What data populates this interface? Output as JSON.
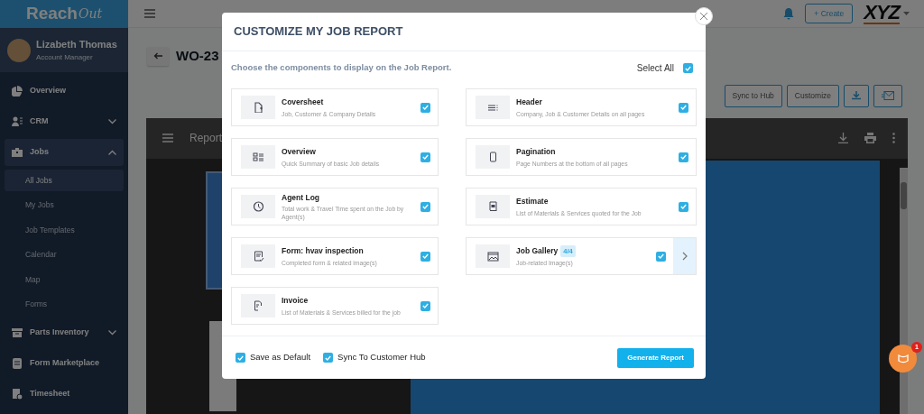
{
  "sidebar": {
    "logo": {
      "main": "Reach",
      "accent": "Out"
    },
    "user": {
      "name": "Lizabeth Thomas",
      "role": "Account Manager"
    },
    "items": [
      {
        "label": "Overview",
        "selected": false
      },
      {
        "label": "CRM",
        "selected": false,
        "expanded": false
      },
      {
        "label": "Jobs",
        "selected": true,
        "expanded": true,
        "children": [
          {
            "label": "All Jobs",
            "selected": true
          },
          {
            "label": "My Jobs",
            "selected": false
          },
          {
            "label": "Job Templates",
            "selected": false
          },
          {
            "label": "Calendar",
            "selected": false
          },
          {
            "label": "Map",
            "selected": false
          },
          {
            "label": "Forms",
            "selected": false
          }
        ]
      },
      {
        "label": "Parts Inventory",
        "selected": false,
        "expanded": false
      },
      {
        "label": "Form Marketplace",
        "selected": false
      },
      {
        "label": "Timesheet",
        "selected": false
      }
    ]
  },
  "topbar": {
    "create_button": "+ Create",
    "brand": "XYZ"
  },
  "page": {
    "title": "WO-23",
    "buttons": [
      "Sync to Hub",
      "Customize"
    ],
    "viewer": {
      "title": "Report"
    }
  },
  "modal": {
    "title": "CUSTOMIZE MY JOB REPORT",
    "subtitle": "Choose the components to display on the Job Report.",
    "select_all": {
      "label": "Select All",
      "checked": true
    },
    "components": [
      {
        "title": "Coversheet",
        "description": "Job, Customer & Company Details",
        "checked": true
      },
      {
        "title": "Header",
        "description": "Company, Job & Customer Details on all pages",
        "checked": true
      },
      {
        "title": "Overview",
        "description": "Quick Summary of basic Job details",
        "checked": true
      },
      {
        "title": "Pagination",
        "description": "Page Numbers at the bottom of all pages",
        "checked": true
      },
      {
        "title": "Agent Log",
        "description": "Total work & Travel Time spent on the Job by Agent(s)",
        "checked": true
      },
      {
        "title": "Estimate",
        "description": "List of Materials & Services quoted for the Job",
        "checked": true
      },
      {
        "title": "Form: hvav inspection",
        "description": "Completed form & related image(s)",
        "checked": true
      },
      {
        "title": "Job Gallery",
        "badge": "4/4",
        "description": "Job-related Image(s)",
        "checked": true,
        "expandable": true
      },
      {
        "title": "Invoice",
        "description": "List of Materials & Services billed for the job",
        "checked": true
      }
    ],
    "options": [
      {
        "label": "Save as Default",
        "checked": true
      },
      {
        "label": "Sync To Customer Hub",
        "checked": true
      }
    ],
    "generate_button": "Generate Report"
  },
  "chat": {
    "badge": "1"
  }
}
